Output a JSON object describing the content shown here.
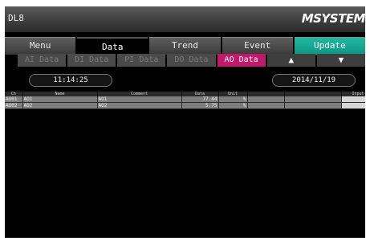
{
  "app": {
    "title": "DL8",
    "brand": "MSYSTEM"
  },
  "main_tabs": [
    "Menu",
    "Data",
    "Trend",
    "Event",
    "Update"
  ],
  "sub_tabs": {
    "ai": "AI Data",
    "di": "DI Data",
    "pi": "PI Data",
    "do": "DO Data",
    "ao": "AO Data",
    "up": "▲",
    "down": "▼"
  },
  "status": {
    "time": "11:14:25",
    "date": "2014/11/19"
  },
  "table": {
    "headers": {
      "ch": "Ch",
      "name": "Name",
      "comment": "Comment",
      "data": "Data",
      "unit": "Unit",
      "blank1": "",
      "blank2": "",
      "input": "Input"
    },
    "rows": [
      {
        "ch": "AO01",
        "name": "AO1",
        "comment": "AO1",
        "data": "77.44",
        "unit": "%",
        "blank1": "",
        "blank2": "",
        "input": ""
      },
      {
        "ch": "AO02",
        "name": "AO2",
        "comment": "AO2",
        "data": "5.75",
        "unit": "%",
        "blank1": "",
        "blank2": "",
        "input": ""
      }
    ]
  },
  "colors": {
    "active_subtab": "#c2196b",
    "update_tab": "#1fb9a3"
  }
}
